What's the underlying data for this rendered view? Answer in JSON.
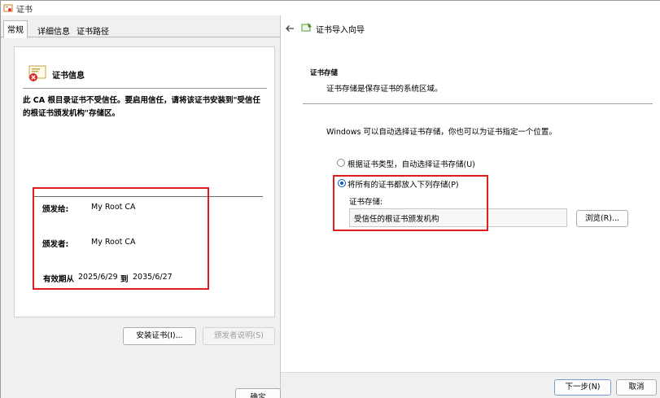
{
  "cert_dialog": {
    "title": "证书",
    "tabs": [
      {
        "label": "常规"
      },
      {
        "label": "详细信息"
      },
      {
        "label": "证书路径"
      }
    ],
    "cert_info_title": "证书信息",
    "warning": "此 CA 根目录证书不受信任。要启用信任，请将该证书安装到\"受信任的根证书颁发机构\"存储区。",
    "issued_to_label": "颁发给:",
    "issued_to_value": "My Root CA",
    "issued_by_label": "颁发者:",
    "issued_by_value": "My Root CA",
    "validity_label": "有效期从",
    "valid_from": "2025/6/29",
    "to_label": "到",
    "valid_to": "2035/6/27",
    "install_button": "安装证书(I)...",
    "issuer_statement_button": "颁发者说明(S)",
    "ok_button": "确定"
  },
  "wizard": {
    "title": "证书导入向导",
    "section_heading": "证书存储",
    "section_description": "证书存储是保存证书的系统区域。",
    "intro": "Windows 可以自动选择证书存储，你也可以为证书指定一个位置。",
    "option_auto": "根据证书类型，自动选择证书存储(U)",
    "option_manual": "将所有的证书都放入下列存储(P)",
    "store_label": "证书存储:",
    "store_value": "受信任的根证书颁发机构",
    "browse_button": "浏览(R)...",
    "next_button": "下一步(N)",
    "cancel_button": "取消"
  },
  "colors": {
    "highlight_border": "#e01e1e",
    "radio_accent": "#005fb8",
    "dialog_bg": "#f0f0f0"
  }
}
